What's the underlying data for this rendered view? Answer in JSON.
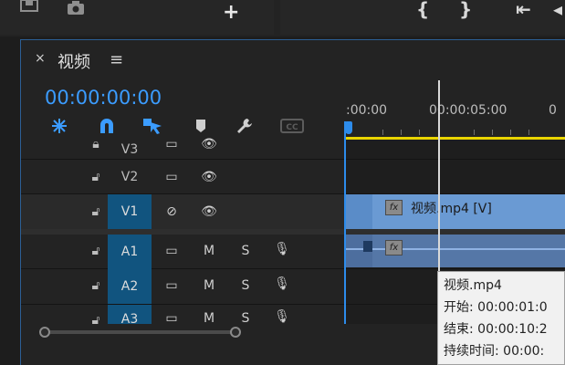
{
  "panel": {
    "title": "视频",
    "close": "×",
    "menu": "≡"
  },
  "timecode": "00:00:00:00",
  "ruler": {
    "labels": [
      ":00:00",
      "00:00:05:00"
    ]
  },
  "tracks": {
    "video": [
      {
        "label": "V3",
        "targeted": false
      },
      {
        "label": "V2",
        "targeted": false
      },
      {
        "label": "V1",
        "targeted": true
      }
    ],
    "audio": [
      {
        "label": "A1",
        "targeted": true,
        "mute": "M",
        "solo": "S"
      },
      {
        "label": "A2",
        "targeted": true,
        "mute": "M",
        "solo": "S"
      },
      {
        "label": "A3",
        "targeted": true,
        "mute": "M",
        "solo": "S"
      }
    ]
  },
  "clip": {
    "video_label": "视频.mp4 [V]",
    "fx": "fx"
  },
  "tooltip": {
    "name": "视频.mp4",
    "start": "开始: 00:00:01:0",
    "end": "结束: 00:00:10:2",
    "duration": "持续时间: 00:00:"
  },
  "tools": {
    "cc": "CC"
  },
  "colors": {
    "accent": "#3b9cff",
    "clip_video": "#6a9ad3",
    "clip_audio": "#5577a7",
    "target": "#11547f",
    "work_area": "#e9d400"
  }
}
